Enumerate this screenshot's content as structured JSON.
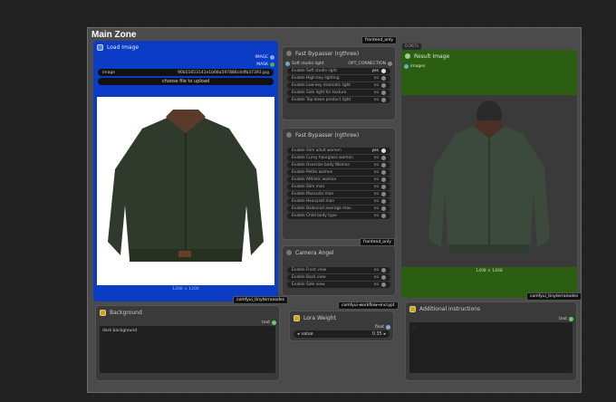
{
  "zone": {
    "title": "Main Zone"
  },
  "tags": {
    "frontend_only_1": "frontend_only",
    "frontend_only_2": "frontend_only",
    "comfyui_tinyterra_1": "comfyui_tinyterranodes",
    "comfyui_tinyterra_2": "comfyui_tinyterranodes",
    "workflow_encrypt": "comfyui-workflow-encrypt",
    "version": "0.067s"
  },
  "load_image": {
    "title": "Load Image",
    "out_image": "IMAGE",
    "out_mask": "MASK",
    "image_label": "image",
    "image_value": "90b51653141e1b68a597886c4dfb37393.jpg",
    "upload_label": "choose file to upload",
    "caption": "1200 × 1200"
  },
  "bypasser1": {
    "title": "Fast Bypasser (rgthree)",
    "input_label": "Soft studio light",
    "output_label": "OPT_CONNECTION",
    "toggles": [
      {
        "label": "Enable Soft studio light",
        "state": "yes",
        "on": true
      },
      {
        "label": "Enable High-key lighting",
        "state": "no",
        "on": false
      },
      {
        "label": "Enable Low-key dramatic light",
        "state": "no",
        "on": false
      },
      {
        "label": "Enable Side light for texture",
        "state": "no",
        "on": false
      },
      {
        "label": "Enable Top-down product light",
        "state": "no",
        "on": false
      }
    ]
  },
  "bypasser2": {
    "title": "Fast Bypasser (rgthree)",
    "toggles": [
      {
        "label": "Enable Slim adult women",
        "state": "yes",
        "on": true
      },
      {
        "label": "Enable Curvy hourglass woman",
        "state": "no",
        "on": false
      },
      {
        "label": "Enable Oversize body Woman",
        "state": "no",
        "on": false
      },
      {
        "label": "Enable Petite women",
        "state": "no",
        "on": false
      },
      {
        "label": "Enable Athletic woman",
        "state": "no",
        "on": false
      },
      {
        "label": "Enable Slim man",
        "state": "no",
        "on": false
      },
      {
        "label": "Enable Muscular man",
        "state": "no",
        "on": false
      },
      {
        "label": "Enable Heavyset man",
        "state": "no",
        "on": false
      },
      {
        "label": "Enable Balanced average man",
        "state": "no",
        "on": false
      },
      {
        "label": "Enable Child body type",
        "state": "no",
        "on": false
      }
    ]
  },
  "camera": {
    "title": "Camera Angel",
    "toggles": [
      {
        "label": "Enable Front view",
        "state": "no",
        "on": false
      },
      {
        "label": "Enable Back view",
        "state": "no",
        "on": false
      },
      {
        "label": "Enable Side view",
        "state": "no",
        "on": false
      }
    ]
  },
  "result": {
    "title": "Result Image",
    "input_label": "images",
    "caption": "1408 × 1408"
  },
  "background": {
    "title": "Background",
    "out": "text",
    "value": "dark background"
  },
  "lora": {
    "title": "Lora Weight",
    "out": "float",
    "label": "value",
    "value": "0.35"
  },
  "additional": {
    "title": "Additional instructions",
    "out": "text",
    "value": "..."
  },
  "colors": {
    "blue_node": "#0a3cc6",
    "green_node": "#2c5e12",
    "dark_node": "#3a3a3a",
    "canvas": "#222223"
  }
}
